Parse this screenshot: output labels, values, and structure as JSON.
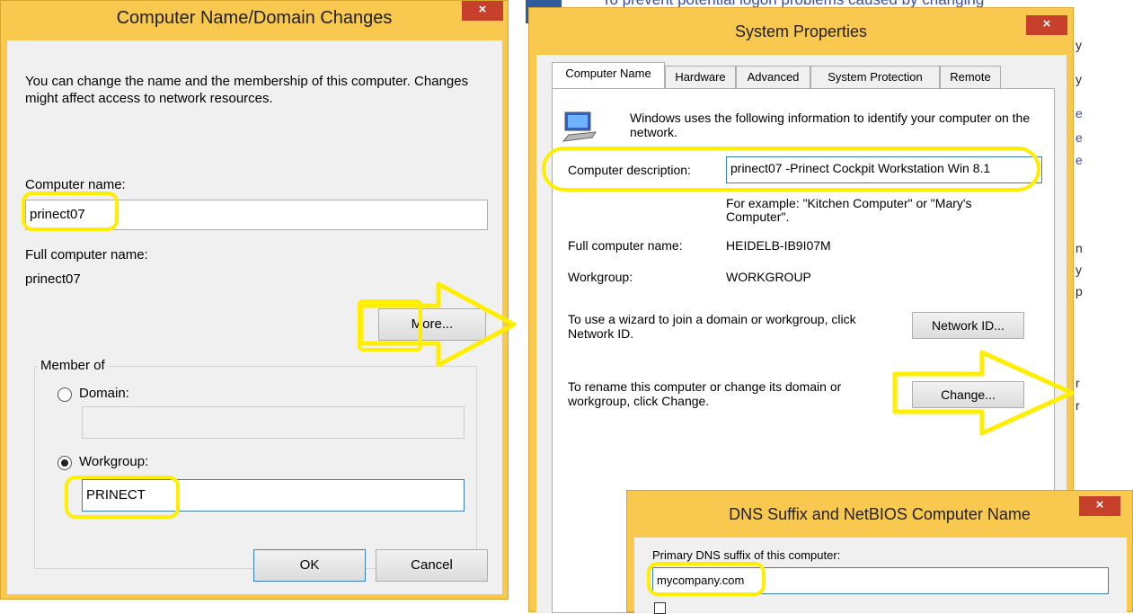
{
  "background_text": {
    "top_banner": "To prevent potential logon problems caused by changing",
    "right_fragments": [
      "y",
      "y",
      "e",
      "e",
      "e",
      "n",
      "y",
      "p",
      "r",
      "r"
    ]
  },
  "dialog1": {
    "title": "Computer Name/Domain Changes",
    "close_label": "×",
    "intro": "You can change the name and the membership of this computer. Changes might affect access to network resources.",
    "computer_name_label": "Computer name:",
    "computer_name_value": "prinect07",
    "full_name_label": "Full computer name:",
    "full_name_value": "prinect07",
    "more_button": "More...",
    "member_of_label": "Member of",
    "domain_label": "Domain:",
    "domain_value": "",
    "workgroup_label": "Workgroup:",
    "workgroup_value": "PRINECT",
    "selected_membership": "Workgroup",
    "ok_button": "OK",
    "cancel_button": "Cancel"
  },
  "dialog2": {
    "title": "System Properties",
    "close_label": "×",
    "tabs": [
      "Computer Name",
      "Hardware",
      "Advanced",
      "System Protection",
      "Remote"
    ],
    "active_tab": "Computer Name",
    "info_text": "Windows uses the following information to identify your computer on the network.",
    "description_label": "Computer description:",
    "description_value": "prinect07 -Prinect Cockpit  Workstation Win 8.1",
    "example_text": "For example: \"Kitchen Computer\" or \"Mary's Computer\".",
    "full_name_label": "Full computer name:",
    "full_name_value": "HEIDELB-IB9I07M",
    "workgroup_label": "Workgroup:",
    "workgroup_value": "WORKGROUP",
    "network_text": "To use a wizard to join a domain or workgroup, click Network ID.",
    "network_button": "Network ID...",
    "rename_text": "To rename this computer or change its domain or workgroup, click Change.",
    "change_button": "Change..."
  },
  "dialog3": {
    "title": "DNS Suffix and NetBIOS Computer Name",
    "close_label": "×",
    "dns_label": "Primary DNS suffix of this computer:",
    "dns_value": "mycompany.com"
  },
  "colors": {
    "window_frame": "#f8c84f",
    "highlight": "#ffee00",
    "close_button": "#c7402c",
    "focus_border": "#3c7fb1"
  },
  "icons": [
    "close-icon",
    "computer-icon",
    "arrow-right-icon",
    "checkbox-checked-icon"
  ]
}
